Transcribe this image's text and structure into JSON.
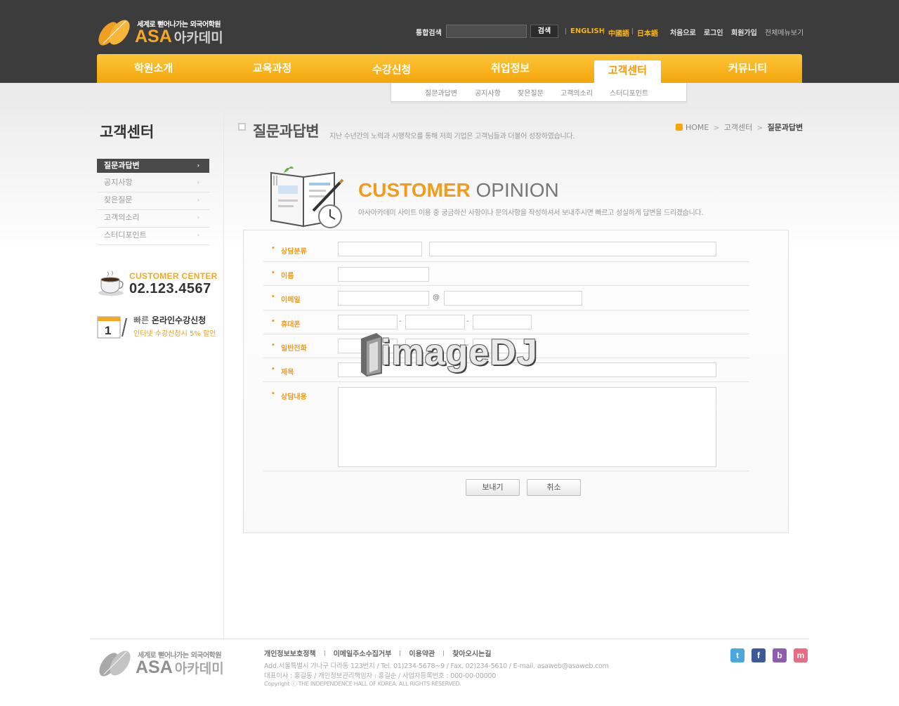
{
  "header": {
    "logo": {
      "tagline": "세계로 뻗어나가는 외국어학원",
      "brand_en": "ASA",
      "brand_ko": "아카데미"
    },
    "search": {
      "label": "통합검색",
      "value": "",
      "button": "검색"
    },
    "languages": [
      "ENGLISH",
      "中國語",
      "日本語"
    ],
    "util_links": [
      "처음으로",
      "로그인",
      "회원가입",
      "전체메뉴보기"
    ],
    "nav": [
      "학원소개",
      "교육과정",
      "수강신청",
      "취업정보",
      "고객센터",
      "커뮤니티"
    ],
    "nav_active": "고객센터",
    "subnav": [
      "질문과답변",
      "공지사항",
      "잦은질문",
      "고객의소리",
      "스터디포인트"
    ]
  },
  "sidebar": {
    "title": "고객센터",
    "items": [
      {
        "label": "질문과답변",
        "active": true
      },
      {
        "label": "공지사항",
        "active": false
      },
      {
        "label": "잦은질문",
        "active": false
      },
      {
        "label": "고객의소리",
        "active": false
      },
      {
        "label": "스터디포인트",
        "active": false
      }
    ],
    "arrow": "›",
    "customer_center": {
      "title": "CUSTOMER CENTER",
      "phone": "02.123.4567"
    },
    "promo": {
      "title_prefix": "빠른",
      "title_strong": "온라인수강신청",
      "subtitle": "인터넷 수강신청시 5% 할인"
    }
  },
  "content": {
    "page_title": "질문과답변",
    "page_desc": "지난 수년간의 노력과 시행착오를 통해 저희 기업은 고객님들과 더불어 성장하였습니다.",
    "breadcrumb": [
      "HOME",
      "고객센터",
      "질문과답변"
    ],
    "breadcrumb_sep": ">",
    "hero": {
      "title_accent": "CUSTOMER",
      "title_rest": "OPINION",
      "desc": "아사아카데미 사이트 이용 중 궁금하신 사항이나 문의사항을 작성하셔서 보내주시면 빠르고 성실하게 답변을 드리겠습니다."
    },
    "form": {
      "labels": {
        "category": "상담분류",
        "name": "이름",
        "email": "이메일",
        "mobile": "휴대폰",
        "phone": "일반전화",
        "subject": "제목",
        "body": "상담내용"
      },
      "at_sign": "@",
      "dash": "-",
      "submit": "보내기",
      "cancel": "취소"
    },
    "watermark": "imageDJ"
  },
  "footer": {
    "logo": {
      "tagline": "세계로 뻗어나가는 외국어학원",
      "brand_en": "ASA",
      "brand_ko": "아카데미"
    },
    "links": [
      "개인정보보호정책",
      "이메일주소수집거부",
      "이용약관",
      "찾아오시는길"
    ],
    "address": "Add.서울특별시 가나구 다라동 123번지  / Tel. 01)234-5678~9  / Fax. 02)234-5610  / E-mail. asaweb@asaweb.com",
    "ceo": "대표이사 : 홍길동 / 개인정보관리책임자 : 홍길순 / 사업자등록번호 : 000-00-00000",
    "copyright": "Copyright ⓒ THE INDEPENDENCE HALL OF KOREA. ALL RIGHTS RESERVED.",
    "sns": [
      {
        "name": "twitter",
        "glyph": "t",
        "color": "#4aa8df"
      },
      {
        "name": "facebook",
        "glyph": "f",
        "color": "#3c5a99"
      },
      {
        "name": "blog",
        "glyph": "b",
        "color": "#8e5dae"
      },
      {
        "name": "me2day",
        "glyph": "m",
        "color": "#e86d82"
      }
    ]
  },
  "colors": {
    "accent": "#f6a823",
    "header_bg": "#3c3c3c",
    "label": "#f29b1c"
  }
}
